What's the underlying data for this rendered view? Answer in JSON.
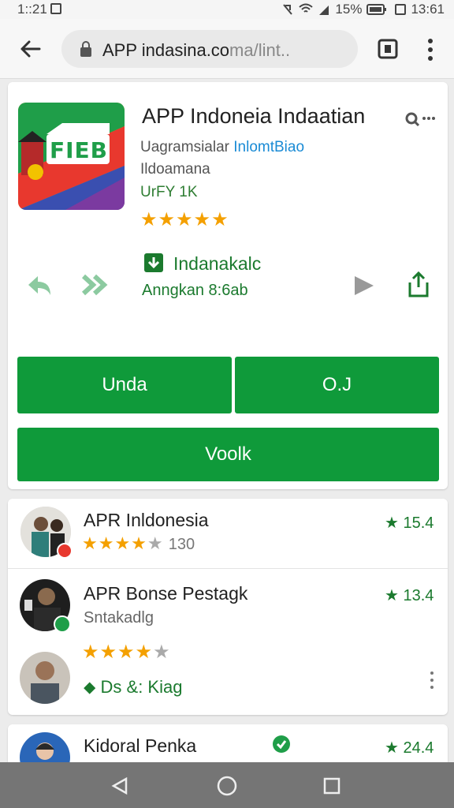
{
  "status_bar": {
    "time": "1::21",
    "battery": "15%",
    "clock": "13:61"
  },
  "browser": {
    "url": "APP indasina.coma/lint..",
    "url_main": "APP indasina.co",
    "url_dim": "ma/lint.."
  },
  "app": {
    "title": "APP Indoneia Indaatian",
    "developer_prefix": "Uagramsialar",
    "developer_link": "InlomtBiao",
    "category": "Ildoamana",
    "size": "UrFY 1K",
    "rating_stars": 4.5,
    "icon_text": "FIEB",
    "download_label": "Indanakalc",
    "download_sub": "Anngkan 8:6ab"
  },
  "buttons": {
    "left": "Unda",
    "right": "O.J",
    "full": "Voolk"
  },
  "list": [
    {
      "name": "APR Inldonesia",
      "rating_text": "130",
      "stars": 3.5,
      "rate": "15.4",
      "sub": ""
    },
    {
      "name": "APR Bonse Pestagk",
      "sub": "Sntakadlg",
      "rate": "13.4",
      "stars": 4.5,
      "extra": "Ds  &: Kiag"
    },
    {
      "name": "Kidoral Penka",
      "rate": "24.4"
    }
  ],
  "colors": {
    "accent": "#0f9a3a",
    "star": "#f4a000",
    "link": "#1a8bd5"
  }
}
